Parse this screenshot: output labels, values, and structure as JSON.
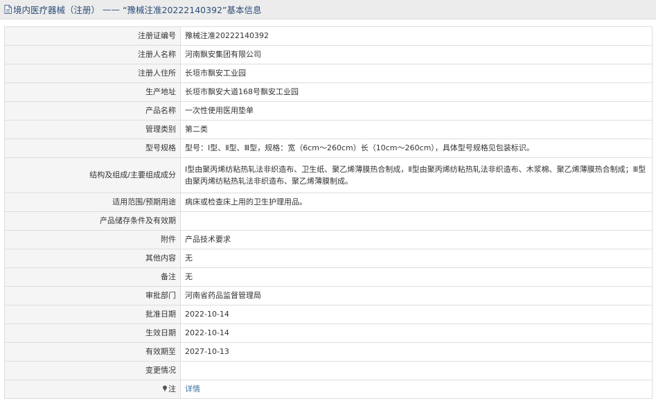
{
  "header": {
    "category": "境内医疗器械（注册）",
    "separator": "——",
    "subject": "“豫械注准20222140392”",
    "suffix": "基本信息"
  },
  "rows": [
    {
      "label": "注册证编号",
      "value": "豫械注准20222140392"
    },
    {
      "label": "注册人名称",
      "value": "河南飘安集团有限公司"
    },
    {
      "label": "注册人住所",
      "value": "长垣市飘安工业园"
    },
    {
      "label": "生产地址",
      "value": "长垣市飘安大道168号飘安工业园"
    },
    {
      "label": "产品名称",
      "value": "一次性使用医用垫单"
    },
    {
      "label": "管理类别",
      "value": "第二类"
    },
    {
      "label": "型号规格",
      "value": "型号：Ⅰ型、Ⅱ型、Ⅲ型，规格：宽（6cm～260cm）长（10cm～260cm），具体型号规格见包装标识。"
    },
    {
      "label": "结构及组成/主要组成成分",
      "value": "Ⅰ型由聚丙烯纺粘热轧法非织造布、卫生纸、聚乙烯薄膜热合制成，Ⅱ型由聚丙烯纺粘热轧法非织造布、木浆棉、聚乙烯薄膜热合制成；Ⅲ型由聚丙烯纺粘热轧法非织造布、聚乙烯薄膜制成。"
    },
    {
      "label": "适用范围/预期用途",
      "value": "病床或检查床上用的卫生护理用品。"
    },
    {
      "label": "产品储存条件及有效期",
      "value": ""
    },
    {
      "label": "附件",
      "value": "产品技术要求"
    },
    {
      "label": "其他内容",
      "value": "无"
    },
    {
      "label": "备注",
      "value": "无"
    },
    {
      "label": "审批部门",
      "value": "河南省药品监督管理局"
    },
    {
      "label": "批准日期",
      "value": "2022-10-14"
    },
    {
      "label": "生效日期",
      "value": "2022-10-14"
    },
    {
      "label": "有效期至",
      "value": "2027-10-13"
    },
    {
      "label": "变更情况",
      "value": ""
    }
  ],
  "note": {
    "label": "注",
    "icon": "pin-icon",
    "link": "详情"
  }
}
